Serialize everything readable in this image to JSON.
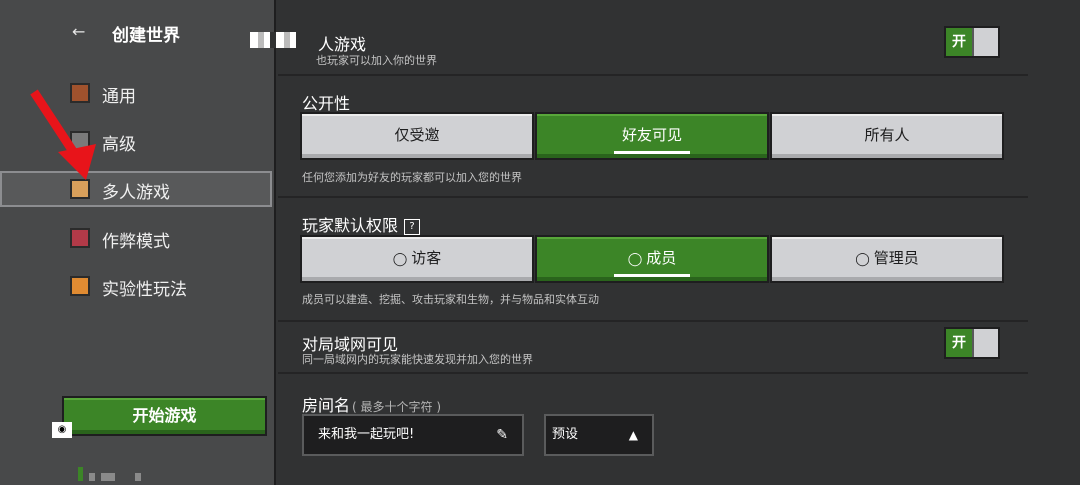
{
  "sidebar": {
    "title": "创建世界",
    "items": [
      {
        "label": "通用",
        "icon": "general-icon",
        "color": "#a0522d"
      },
      {
        "label": "高级",
        "icon": "advanced-icon",
        "color": "#7a7a7a"
      },
      {
        "label": "多人游戏",
        "icon": "multiplayer-icon",
        "color": "#d9a05b"
      },
      {
        "label": "作弊模式",
        "icon": "cheats-icon",
        "color": "#b23a48"
      },
      {
        "label": "实验性玩法",
        "icon": "experiments-icon",
        "color": "#e08b32"
      }
    ],
    "start_button": "开始游戏"
  },
  "main": {
    "multiplayer": {
      "title": "人游戏",
      "desc": "也玩家可以加入你的世界",
      "toggle": "开"
    },
    "visibility": {
      "title": "公开性",
      "options": [
        "仅受邀",
        "好友可见",
        "所有人"
      ],
      "selected": "好友可见",
      "desc": "任何您添加为好友的玩家都可以加入您的世界"
    },
    "permissions": {
      "title": "玩家默认权限",
      "help": "?",
      "options": [
        "访客",
        "成员",
        "管理员"
      ],
      "selected": "成员",
      "desc": "成员可以建造、挖掘、攻击玩家和生物，并与物品和实体互动"
    },
    "lan": {
      "title": "对局域网可见",
      "desc": "同一局域网内的玩家能快速发现并加入您的世界",
      "toggle": "开"
    },
    "room": {
      "title": "房间名",
      "hint": "( 最多十个字符 )",
      "value": "来和我一起玩吧!",
      "preset": "预设"
    }
  },
  "colors": {
    "accent": "#3c8527",
    "panel": "#48494a",
    "background": "#313233",
    "button": "#d0d1d4"
  }
}
